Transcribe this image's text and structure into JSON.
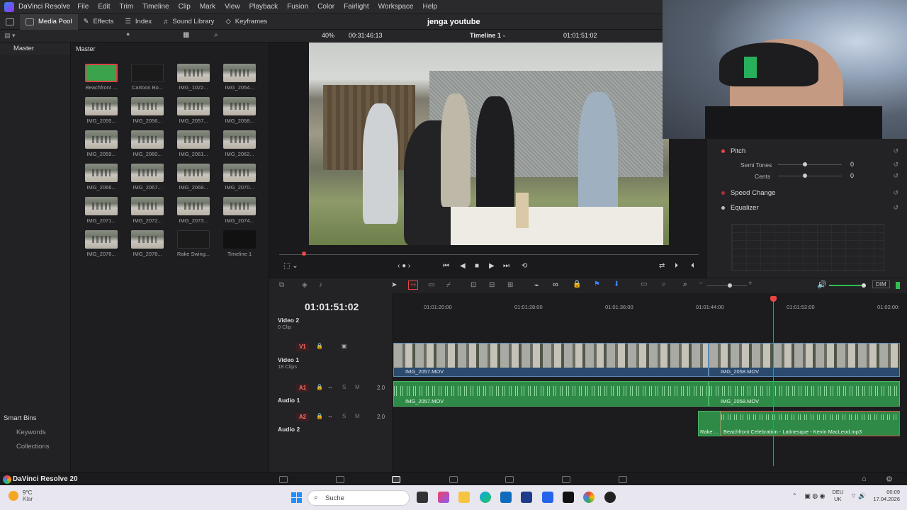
{
  "menubar": {
    "app_name": "DaVinci Resolve",
    "items": [
      "File",
      "Edit",
      "Trim",
      "Timeline",
      "Clip",
      "Mark",
      "View",
      "Playback",
      "Fusion",
      "Color",
      "Fairlight",
      "Workspace",
      "Help"
    ]
  },
  "toolbar": {
    "media_pool": "Media Pool",
    "effects": "Effects",
    "index": "Index",
    "sound_library": "Sound Library",
    "keyframes": "Keyframes",
    "project_title": "jenga youtube"
  },
  "viewer": {
    "zoom": "40%",
    "source_timecode": "00:31:46:13",
    "timeline_name": "Timeline 1",
    "record_timecode": "01:01:51:02"
  },
  "bins": {
    "master": "Master"
  },
  "media_pool": {
    "header": "Master",
    "clips": [
      {
        "name": "Beachfront ...",
        "kind": "green"
      },
      {
        "name": "Cartoon Bo...",
        "kind": "dark"
      },
      {
        "name": "IMG_1022...",
        "kind": "video"
      },
      {
        "name": "IMG_2054...",
        "kind": "video"
      },
      {
        "name": "IMG_2055...",
        "kind": "video"
      },
      {
        "name": "IMG_2056...",
        "kind": "video"
      },
      {
        "name": "IMG_2057...",
        "kind": "video"
      },
      {
        "name": "IMG_2058...",
        "kind": "video"
      },
      {
        "name": "IMG_2059...",
        "kind": "video"
      },
      {
        "name": "IMG_2060...",
        "kind": "video"
      },
      {
        "name": "IMG_2061...",
        "kind": "video"
      },
      {
        "name": "IMG_2062...",
        "kind": "video"
      },
      {
        "name": "IMG_2066...",
        "kind": "video"
      },
      {
        "name": "IMG_2067...",
        "kind": "video"
      },
      {
        "name": "IMG_2069...",
        "kind": "video"
      },
      {
        "name": "IMG_2070...",
        "kind": "video"
      },
      {
        "name": "IMG_2071...",
        "kind": "video"
      },
      {
        "name": "IMG_2072...",
        "kind": "video"
      },
      {
        "name": "IMG_2073...",
        "kind": "video"
      },
      {
        "name": "IMG_2074...",
        "kind": "video"
      },
      {
        "name": "IMG_2076...",
        "kind": "video"
      },
      {
        "name": "IMG_2078...",
        "kind": "video"
      },
      {
        "name": "Rake Swing...",
        "kind": "dark"
      },
      {
        "name": "Timeline 1",
        "kind": "timeline"
      }
    ]
  },
  "smart_bins": {
    "title": "Smart Bins",
    "items": [
      "Keywords",
      "Collections"
    ]
  },
  "inspector": {
    "pitch": "Pitch",
    "semi_tones_label": "Semi Tones",
    "semi_tones_value": "0",
    "cents_label": "Cents",
    "cents_value": "0",
    "speed_change": "Speed Change",
    "equalizer": "Equalizer"
  },
  "timeline": {
    "timecode": "01:01:51:02",
    "ruler": [
      "01:01:20:00",
      "01:01:28:00",
      "01:01:36:00",
      "01:01:44:00",
      "01:01:52:00",
      "01:02:00:"
    ],
    "tracks": {
      "v2_name": "Video 2",
      "v2_sub": "0 Clip",
      "v1_badge": "V1",
      "v1_name": "Video 1",
      "v1_sub": "18 Clips",
      "a1_badge": "A1",
      "a1_name": "Audio 1",
      "a1_level": "2.0",
      "a2_badge": "A2",
      "a2_name": "Audio 2",
      "a2_level": "2.0"
    },
    "clips": {
      "v1_a": "IMG_2057.MOV",
      "v1_b": "IMG_2058.MOV",
      "a1_a": "IMG_2057.MOV",
      "a1_b": "IMG_2058.MOV",
      "a2_a": "Rake ...",
      "a2_b": "Beachfront Celebration - Latinesque - Kevin MacLeod.mp3"
    },
    "dim_label": "DIM"
  },
  "page_bar": {
    "brand": "DaVinci Resolve 20"
  },
  "taskbar": {
    "weather_temp": "9°C",
    "weather_text": "Klar",
    "search": "Suche",
    "lang_1": "DEU",
    "lang_2": "UK",
    "time": "00:09",
    "date": "17.04.2026"
  }
}
